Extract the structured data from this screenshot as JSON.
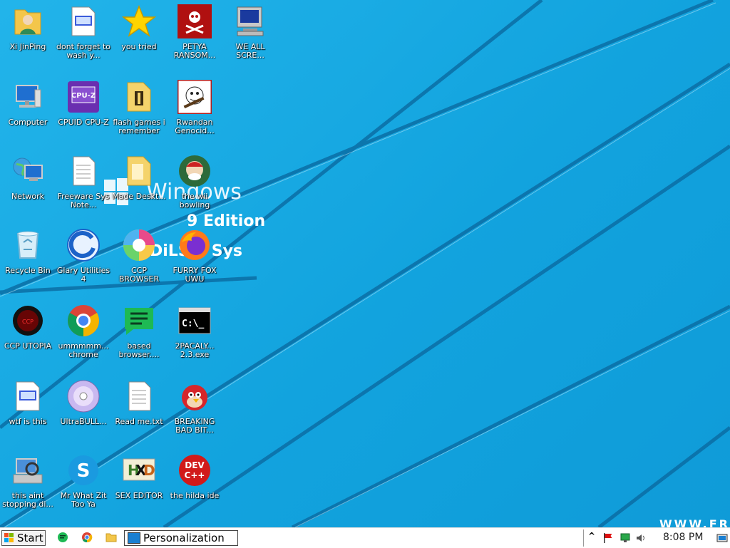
{
  "wallpaper": {
    "title": "Windows",
    "edition": "9 Edition",
    "sys": "DiLS      d Sys",
    "url": "WWW.FR"
  },
  "icons": [
    {
      "label": "Xi JinPing"
    },
    {
      "label": "dont forget to wash y..."
    },
    {
      "label": "you tried"
    },
    {
      "label": "PETYA RANSOM..."
    },
    {
      "label": "WE ALL SCRE..."
    },
    {
      "label": "Computer"
    },
    {
      "label": "CPUID CPU-Z"
    },
    {
      "label": "flash games i remember"
    },
    {
      "label": "Rwandan Genocid..."
    },
    {
      "label": "Network"
    },
    {
      "label": "Freeware Sys Note..."
    },
    {
      "label": "Made Deskt..."
    },
    {
      "label": "the wii bowling"
    },
    {
      "label": "Recycle Bin"
    },
    {
      "label": "Glary Utilities 4"
    },
    {
      "label": "CCP BROWSER"
    },
    {
      "label": "FURRY FOX UWU"
    },
    {
      "label": "CCP UTOPIA"
    },
    {
      "label": "ummmmm... chrome"
    },
    {
      "label": "based browser...."
    },
    {
      "label": "2PACALY... 2.3.exe"
    },
    {
      "label": "wtf is this"
    },
    {
      "label": "UltraBULL..."
    },
    {
      "label": "Read me.txt"
    },
    {
      "label": "BREAKING BAD BIT..."
    },
    {
      "label": "this aint stopping di..."
    },
    {
      "label": "Mr What Zit Too Ya"
    },
    {
      "label": "SEX EDITOR"
    },
    {
      "label": "the hilda ide"
    }
  ],
  "taskbar": {
    "start_label": "Start",
    "task_label": "Personalization",
    "clock": "8:08 PM",
    "tray_chevron": "^"
  }
}
